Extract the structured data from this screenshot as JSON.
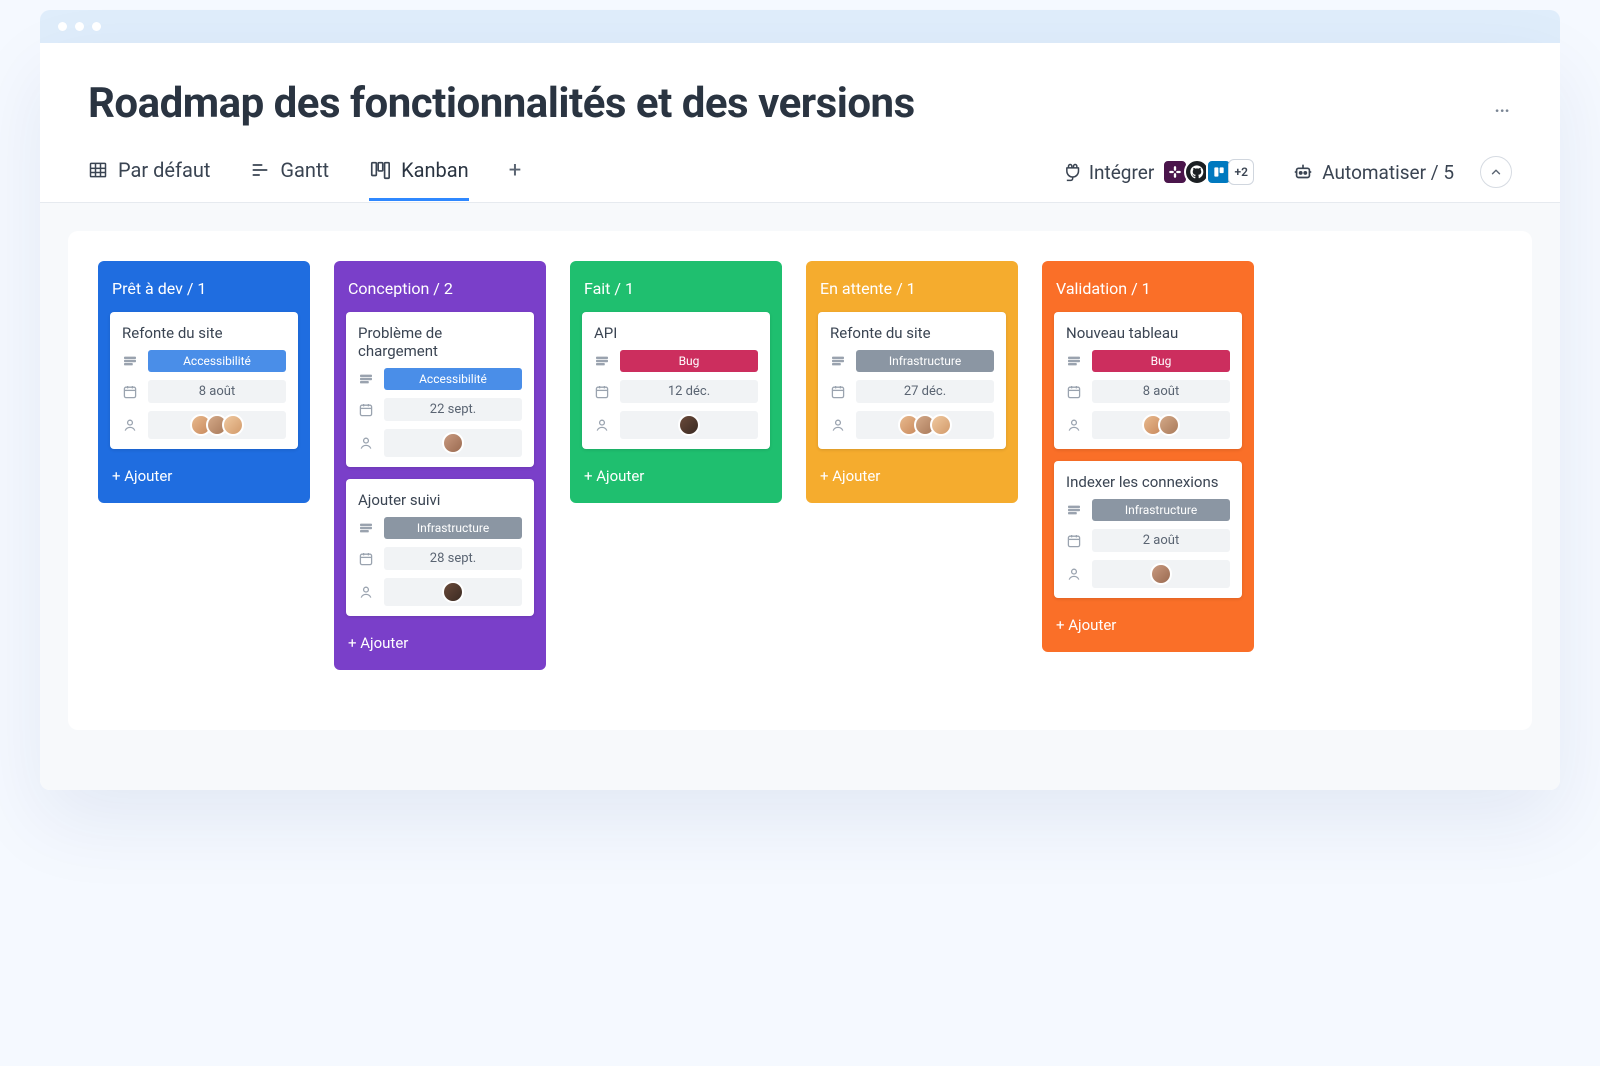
{
  "header": {
    "title": "Roadmap des fonctionnalités et des versions",
    "more_label": "…"
  },
  "toolbar": {
    "views": [
      {
        "id": "default",
        "label": "Par défaut",
        "icon": "grid"
      },
      {
        "id": "gantt",
        "label": "Gantt",
        "icon": "gantt"
      },
      {
        "id": "kanban",
        "label": "Kanban",
        "icon": "kanban",
        "active": true
      }
    ],
    "add_view_label": "+",
    "integrate_label": "Intégrer",
    "integration_icons": [
      {
        "name": "slack",
        "color": "#4a154b"
      },
      {
        "name": "github",
        "color": "#1b1f23"
      },
      {
        "name": "trello",
        "color": "#0079bf"
      }
    ],
    "integration_more": "+2",
    "automate_label": "Automatiser / 5"
  },
  "board": {
    "columns": [
      {
        "id": "ready",
        "color": "blue",
        "title": "Prêt à dev / 1",
        "add_label": "+ Ajouter",
        "cards": [
          {
            "title": "Refonte du site",
            "tag": {
              "label": "Accessibilité",
              "style": "access"
            },
            "date": "8 août",
            "avatars": [
              "a",
              "b",
              "c"
            ]
          }
        ]
      },
      {
        "id": "design",
        "color": "purple",
        "title": "Conception / 2",
        "add_label": "+ Ajouter",
        "cards": [
          {
            "title": "Problème de chargement",
            "tag": {
              "label": "Accessibilité",
              "style": "access"
            },
            "date": "22 sept.",
            "avatars": [
              "e"
            ]
          },
          {
            "title": "Ajouter suivi",
            "tag": {
              "label": "Infrastructure",
              "style": "infra"
            },
            "date": "28 sept.",
            "avatars": [
              "d"
            ]
          }
        ]
      },
      {
        "id": "done",
        "color": "green",
        "title": "Fait / 1",
        "add_label": "+ Ajouter",
        "cards": [
          {
            "title": "API",
            "tag": {
              "label": "Bug",
              "style": "bug"
            },
            "date": "12 déc.",
            "avatars": [
              "d"
            ]
          }
        ]
      },
      {
        "id": "waiting",
        "color": "yellow",
        "title": "En attente / 1",
        "add_label": "+ Ajouter",
        "cards": [
          {
            "title": "Refonte du site",
            "tag": {
              "label": "Infrastructure",
              "style": "infra"
            },
            "date": "27 déc.",
            "avatars": [
              "a",
              "b",
              "c"
            ]
          }
        ]
      },
      {
        "id": "validation",
        "color": "orange",
        "title": "Validation / 1",
        "add_label": "+ Ajouter",
        "cards": [
          {
            "title": "Nouveau tableau",
            "tag": {
              "label": "Bug",
              "style": "bug"
            },
            "date": "8 août",
            "avatars": [
              "a",
              "b"
            ]
          },
          {
            "title": "Indexer les connexions",
            "tag": {
              "label": "Infrastructure",
              "style": "infra"
            },
            "date": "2 août",
            "avatars": [
              "e"
            ]
          }
        ]
      }
    ]
  }
}
